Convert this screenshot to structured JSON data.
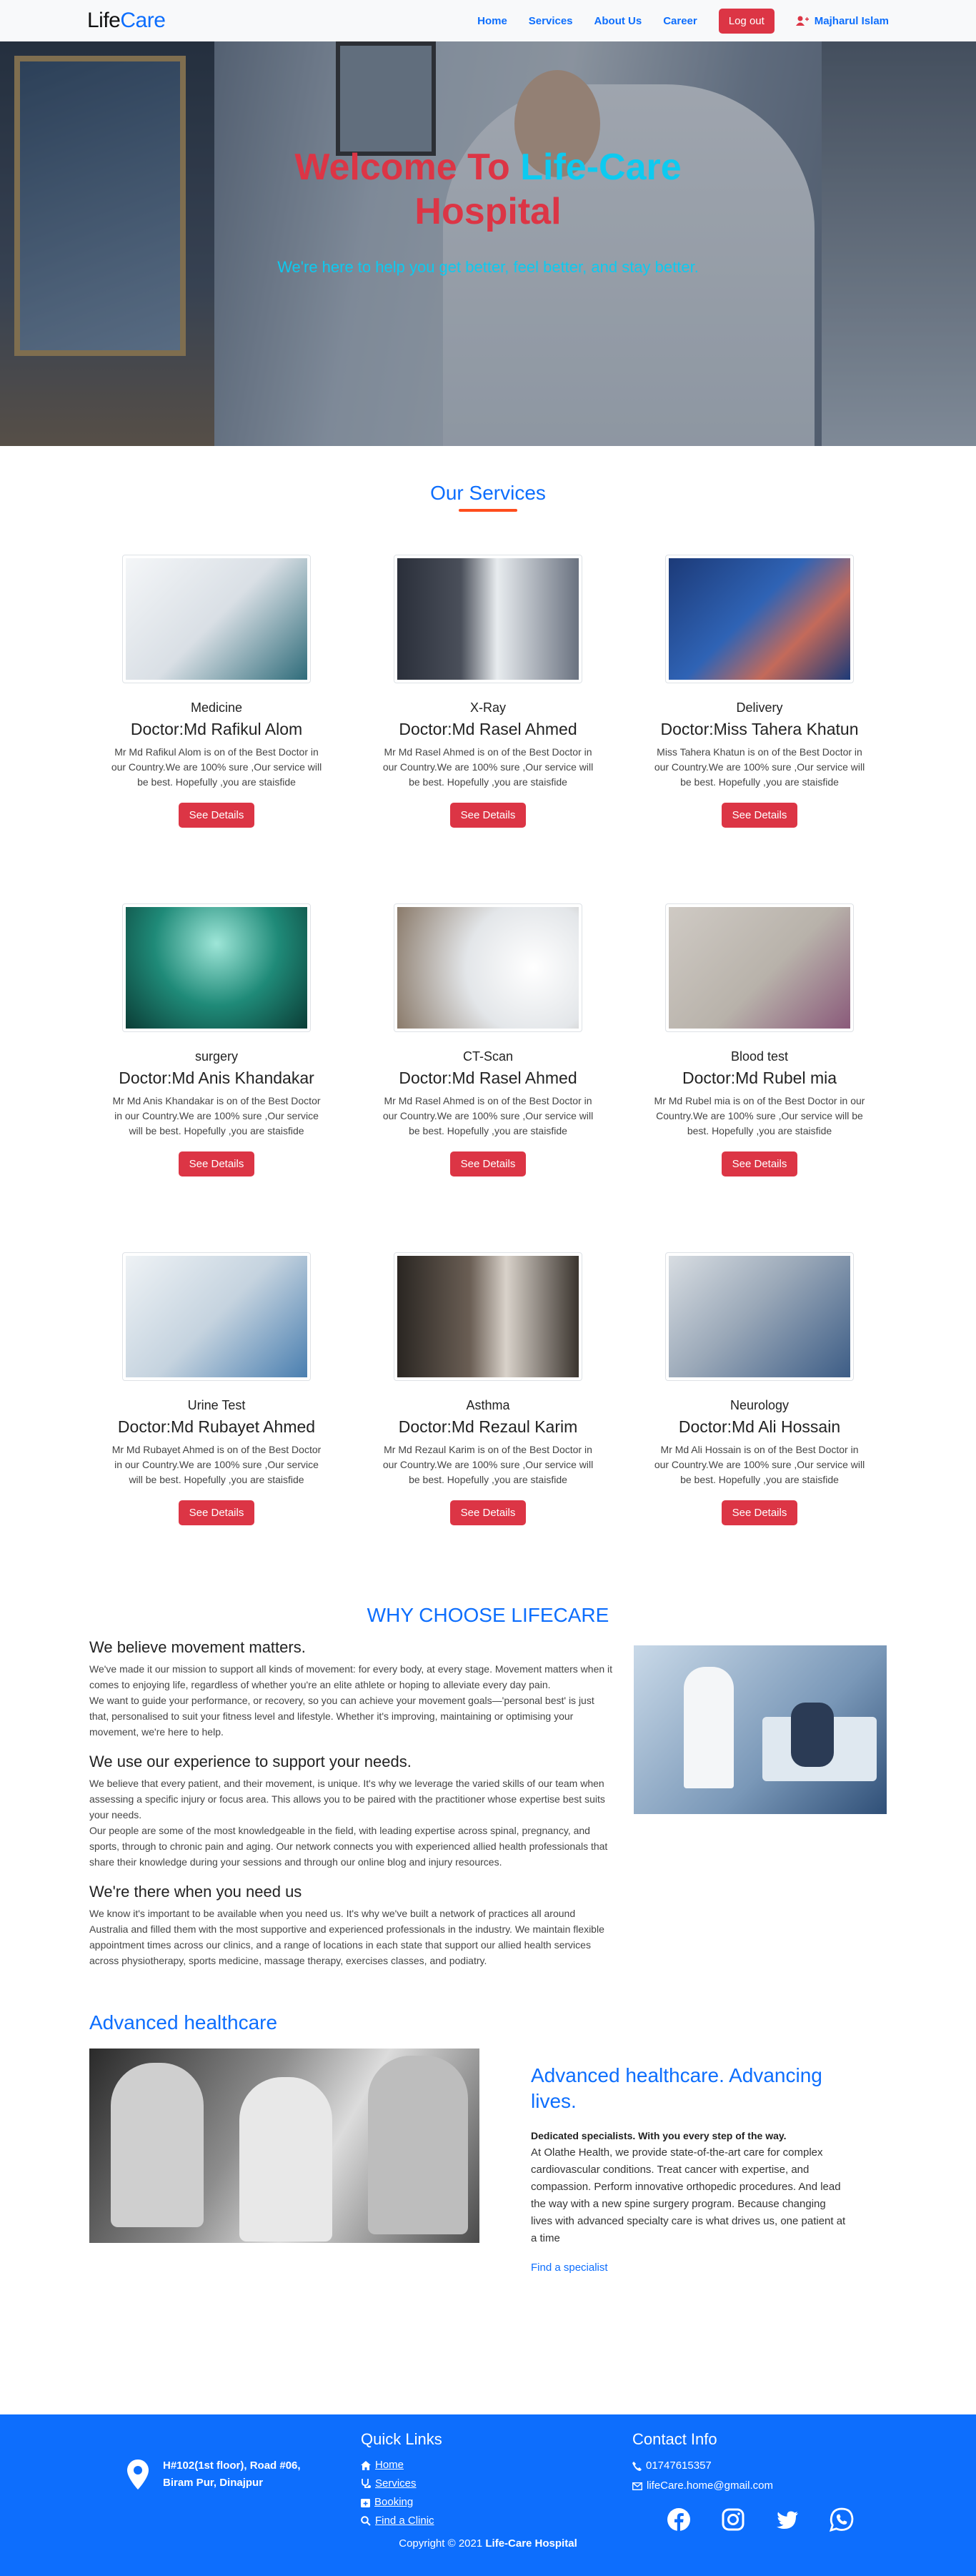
{
  "nav": {
    "brand_prefix": "Life",
    "brand_suffix": "Care",
    "links": [
      "Home",
      "Services",
      "About Us",
      "Career"
    ],
    "logout_label": "Log out",
    "user_name": "Majharul Islam"
  },
  "hero": {
    "title_red_1": "Welcome To ",
    "title_cyan": "Life-Care",
    "title_red_2": "Hospital",
    "subtitle": "We're here to help you get better, feel better, and stay better."
  },
  "services": {
    "heading": "Our Services",
    "button_label": "See Details",
    "cards": [
      {
        "category": "Medicine",
        "doctor": "Doctor:Md Rafikul Alom",
        "desc": "Mr Md Rafikul Alom is on of the Best Doctor in our Country.We are 100% sure ,Our service will be best. Hopefully ,you are staisfide"
      },
      {
        "category": "X-Ray",
        "doctor": "Doctor:Md Rasel Ahmed",
        "desc": "Mr Md Rasel Ahmed is on of the Best Doctor in our Country.We are 100% sure ,Our service will be best. Hopefully ,you are staisfide"
      },
      {
        "category": "Delivery",
        "doctor": "Doctor:Miss Tahera Khatun",
        "desc": "Miss Tahera Khatun is on of the Best Doctor in our Country.We are 100% sure ,Our service will be best. Hopefully ,you are staisfide"
      },
      {
        "category": "surgery",
        "doctor": "Doctor:Md Anis Khandakar",
        "desc": "Mr Md Anis Khandakar is on of the Best Doctor in our Country.We are 100% sure ,Our service will be best. Hopefully ,you are staisfide"
      },
      {
        "category": "CT-Scan",
        "doctor": "Doctor:Md Rasel Ahmed",
        "desc": "Mr Md Rasel Ahmed is on of the Best Doctor in our Country.We are 100% sure ,Our service will be best. Hopefully ,you are staisfide"
      },
      {
        "category": "Blood test",
        "doctor": "Doctor:Md Rubel mia",
        "desc": "Mr Md Rubel mia is on of the Best Doctor in our Country.We are 100% sure ,Our service will be best. Hopefully ,you are staisfide"
      },
      {
        "category": "Urine Test",
        "doctor": "Doctor:Md Rubayet Ahmed",
        "desc": "Mr Md Rubayet Ahmed is on of the Best Doctor in our Country.We are 100% sure ,Our service will be best. Hopefully ,you are staisfide"
      },
      {
        "category": "Asthma",
        "doctor": "Doctor:Md Rezaul Karim",
        "desc": "Mr Md Rezaul Karim is on of the Best Doctor in our Country.We are 100% sure ,Our service will be best. Hopefully ,you are staisfide"
      },
      {
        "category": "Neurology",
        "doctor": "Doctor:Md Ali Hossain",
        "desc": "Mr Md Ali Hossain is on of the Best Doctor in our Country.We are 100% sure ,Our service will be best. Hopefully ,you are staisfide"
      }
    ]
  },
  "why": {
    "heading": "WHY CHOOSE LIFECARE",
    "h1": "We believe movement matters.",
    "p1a": "We've made it our mission to support all kinds of movement: for every body, at every stage. Movement matters when it comes to enjoying life, regardless of whether you're an elite athlete or hoping to alleviate every day pain.",
    "p1b": "We want to guide your performance, or recovery, so you can achieve your movement goals—'personal best' is just that, personalised to suit your fitness level and lifestyle. Whether it's improving, maintaining or optimising your movement, we're here to help.",
    "h2": "We use our experience to support your needs.",
    "p2a": "We believe that every patient, and their movement, is unique. It's why we leverage the varied skills of our team when assessing a specific injury or focus area. This allows you to be paired with the practitioner whose expertise best suits your needs.",
    "p2b": "Our people are some of the most knowledgeable in the field, with leading expertise across spinal, pregnancy, and sports, through to chronic pain and aging. Our network connects you with experienced allied health professionals that share their knowledge during your sessions and through our online blog and injury resources.",
    "h3": "We're there when you need us",
    "p3": "We know it's important to be available when you need us. It's why we've built a network of practices all around Australia and filled them with the most supportive and experienced professionals in the industry. We maintain flexible appointment times across our clinics, and a range of locations in each state that support our allied health services across physiotherapy, sports medicine, massage therapy, exercises classes, and podiatry."
  },
  "advanced": {
    "heading": "Advanced healthcare",
    "title": "Advanced healthcare. Advancing lives.",
    "lead": "Dedicated specialists. With you every step of the way.",
    "body": "At Olathe Health, we provide state-of-the-art care for complex cardiovascular conditions. Treat cancer with expertise, and compassion. Perform innovative orthopedic procedures. And lead the way with a new spine surgery program. Because changing lives with advanced specialty care is what drives us, one patient at a time",
    "link": "Find a specialist"
  },
  "footer": {
    "address_line1": "H#102(1st floor), Road #06,",
    "address_line2": "Biram Pur, Dinajpur",
    "quick_links_title": "Quick Links",
    "quick_links": [
      "Home",
      "Services",
      "Booking",
      "Find a Clinic"
    ],
    "contact_title": "Contact Info",
    "phone": "01747615357",
    "email": "lifeCare.home@gmail.com",
    "copyright_prefix": "Copyright © 2021 ",
    "copyright_brand": "Life-Care Hospital"
  }
}
